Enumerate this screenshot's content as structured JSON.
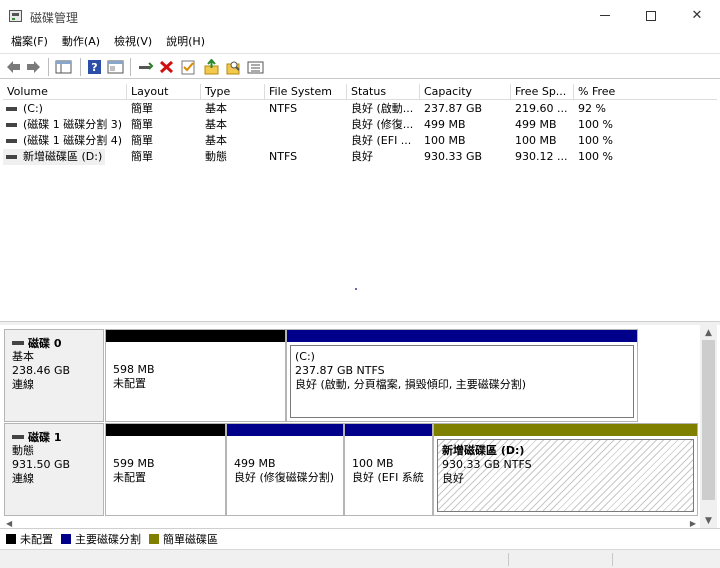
{
  "window": {
    "title": "磁碟管理",
    "min_icon": "minimize-icon",
    "max_icon": "maximize-icon",
    "close_icon": "close-icon"
  },
  "menu": [
    "檔案(F)",
    "動作(A)",
    "檢視(V)",
    "說明(H)"
  ],
  "toolbar": {
    "icons": [
      "back-arrow-icon",
      "forward-arrow-icon",
      "console-tree-icon",
      "help-icon",
      "properties-icon",
      "connect-icon",
      "delete-icon",
      "checklist-icon",
      "import-icon",
      "search-folder-icon",
      "list-view-icon"
    ]
  },
  "volume_list": {
    "columns": [
      "Volume",
      "Layout",
      "Type",
      "File System",
      "Status",
      "Capacity",
      "Free Sp...",
      "% Free"
    ],
    "rows": [
      {
        "volume": "(C:)",
        "layout": "簡單",
        "type": "基本",
        "fs": "NTFS",
        "status": "良好 (啟動...",
        "capacity": "237.87 GB",
        "free": "219.60 ...",
        "pct": "92 %"
      },
      {
        "volume": "(磁碟 1 磁碟分割 3)",
        "layout": "簡單",
        "type": "基本",
        "fs": "",
        "status": "良好 (修復...",
        "capacity": "499 MB",
        "free": "499 MB",
        "pct": "100 %"
      },
      {
        "volume": "(磁碟 1 磁碟分割 4)",
        "layout": "簡單",
        "type": "基本",
        "fs": "",
        "status": "良好 (EFI ...",
        "capacity": "100 MB",
        "free": "100 MB",
        "pct": "100 %"
      },
      {
        "volume": "新增磁碟區 (D:)",
        "layout": "簡單",
        "type": "動態",
        "fs": "NTFS",
        "status": "良好",
        "capacity": "930.33 GB",
        "free": "930.12 ...",
        "pct": "100 %"
      }
    ]
  },
  "disks": [
    {
      "name": "磁碟 0",
      "kind": "基本",
      "size": "238.46 GB",
      "state": "連線",
      "partitions": [
        {
          "bar_color": "#000000",
          "title": "",
          "line1": "598 MB",
          "line2": "未配置",
          "hatched": false
        },
        {
          "bar_color": "#00008b",
          "title": "(C:)",
          "line1": "237.87 GB NTFS",
          "line2": "良好 (啟動, 分頁檔案, 損毀傾印, 主要磁碟分割)",
          "hatched": false
        }
      ]
    },
    {
      "name": "磁碟 1",
      "kind": "動態",
      "size": "931.50 GB",
      "state": "連線",
      "partitions": [
        {
          "bar_color": "#000000",
          "title": "",
          "line1": "599 MB",
          "line2": "未配置",
          "hatched": false
        },
        {
          "bar_color": "#00008b",
          "title": "",
          "line1": "499 MB",
          "line2": "良好 (修復磁碟分割)",
          "hatched": false
        },
        {
          "bar_color": "#00008b",
          "title": "",
          "line1": "100 MB",
          "line2": "良好 (EFI 系統",
          "hatched": false
        },
        {
          "bar_color": "#808000",
          "title": "新增磁碟區 (D:)",
          "line1": "930.33 GB NTFS",
          "line2": "良好",
          "hatched": true
        }
      ]
    }
  ],
  "legend": [
    {
      "label": "未配置",
      "color": "#000000"
    },
    {
      "label": "主要磁碟分割",
      "color": "#00008b"
    },
    {
      "label": "簡單磁碟區",
      "color": "#808000"
    }
  ]
}
